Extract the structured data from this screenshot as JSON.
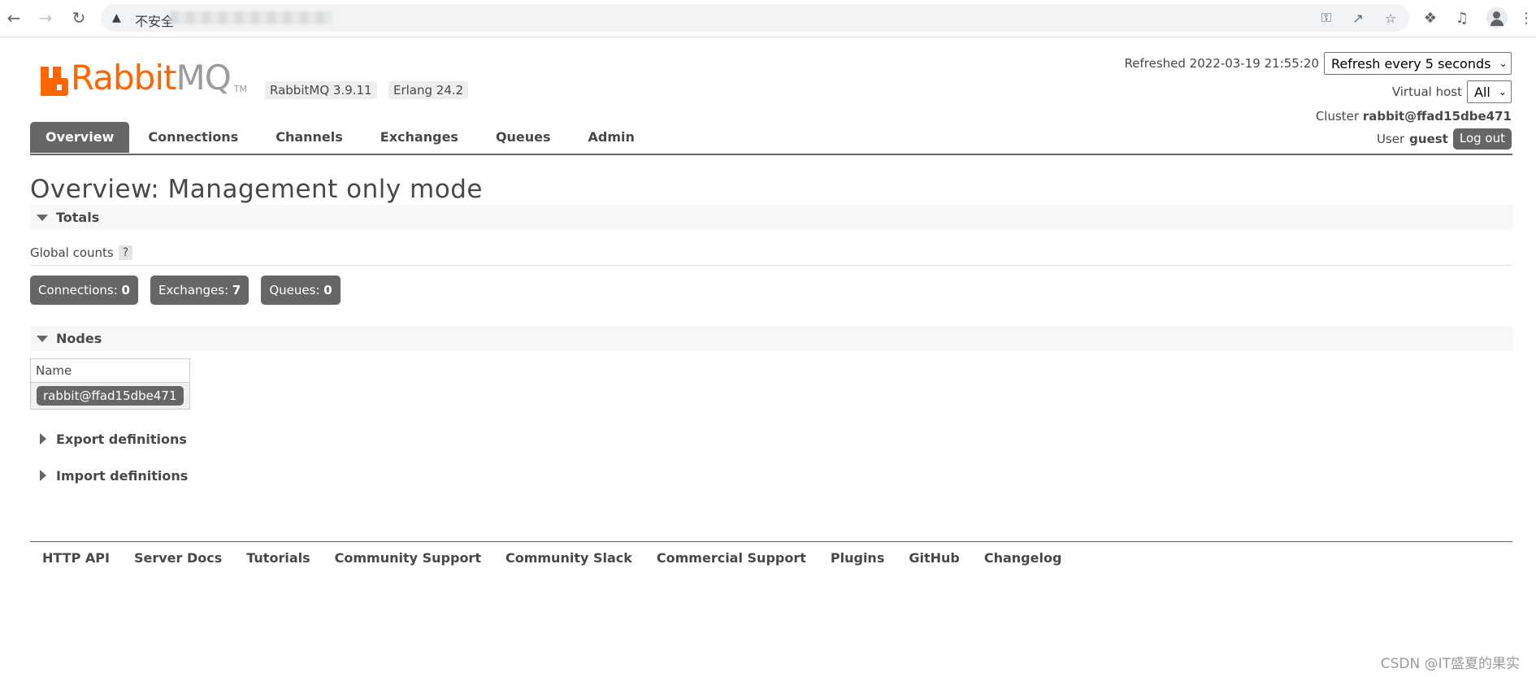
{
  "browser": {
    "insecure_label": "不安全",
    "icons": [
      "back-arrow-icon",
      "forward-arrow-icon",
      "reload-icon",
      "warning-icon",
      "key-icon",
      "share-icon",
      "star-icon",
      "puzzle-icon",
      "media-icon",
      "profile-icon",
      "menu-icon"
    ]
  },
  "header": {
    "logo_rabbit": "Rabbit",
    "logo_mq": "MQ",
    "logo_tm": "TM",
    "version_badge": "RabbitMQ 3.9.11",
    "erlang_badge": "Erlang 24.2",
    "refreshed_label": "Refreshed 2022-03-19 21:55:20",
    "refresh_select": "Refresh every 5 seconds",
    "vhost_label": "Virtual host",
    "vhost_select": "All",
    "cluster_label": "Cluster",
    "cluster_name": "rabbit@ffad15dbe471",
    "user_label": "User",
    "user_name": "guest",
    "logout_label": "Log out"
  },
  "tabs": [
    {
      "label": "Overview",
      "active": true
    },
    {
      "label": "Connections",
      "active": false
    },
    {
      "label": "Channels",
      "active": false
    },
    {
      "label": "Exchanges",
      "active": false
    },
    {
      "label": "Queues",
      "active": false
    },
    {
      "label": "Admin",
      "active": false
    }
  ],
  "main": {
    "title": "Overview: Management only mode",
    "totals_label": "Totals",
    "global_counts_label": "Global counts",
    "help_label": "?",
    "counts": [
      {
        "label": "Connections:",
        "value": "0"
      },
      {
        "label": "Exchanges:",
        "value": "7"
      },
      {
        "label": "Queues:",
        "value": "0"
      }
    ],
    "nodes_label": "Nodes",
    "nodes_table": {
      "header": "Name",
      "rows": [
        "rabbit@ffad15dbe471"
      ]
    },
    "export_label": "Export definitions",
    "import_label": "Import definitions"
  },
  "footer": {
    "links": [
      "HTTP API",
      "Server Docs",
      "Tutorials",
      "Community Support",
      "Community Slack",
      "Commercial Support",
      "Plugins",
      "GitHub",
      "Changelog"
    ]
  },
  "watermark": "CSDN @IT盛夏的果实",
  "colors": {
    "brand_orange": "#ff6600",
    "tab_active": "#666666",
    "text": "#484848"
  }
}
